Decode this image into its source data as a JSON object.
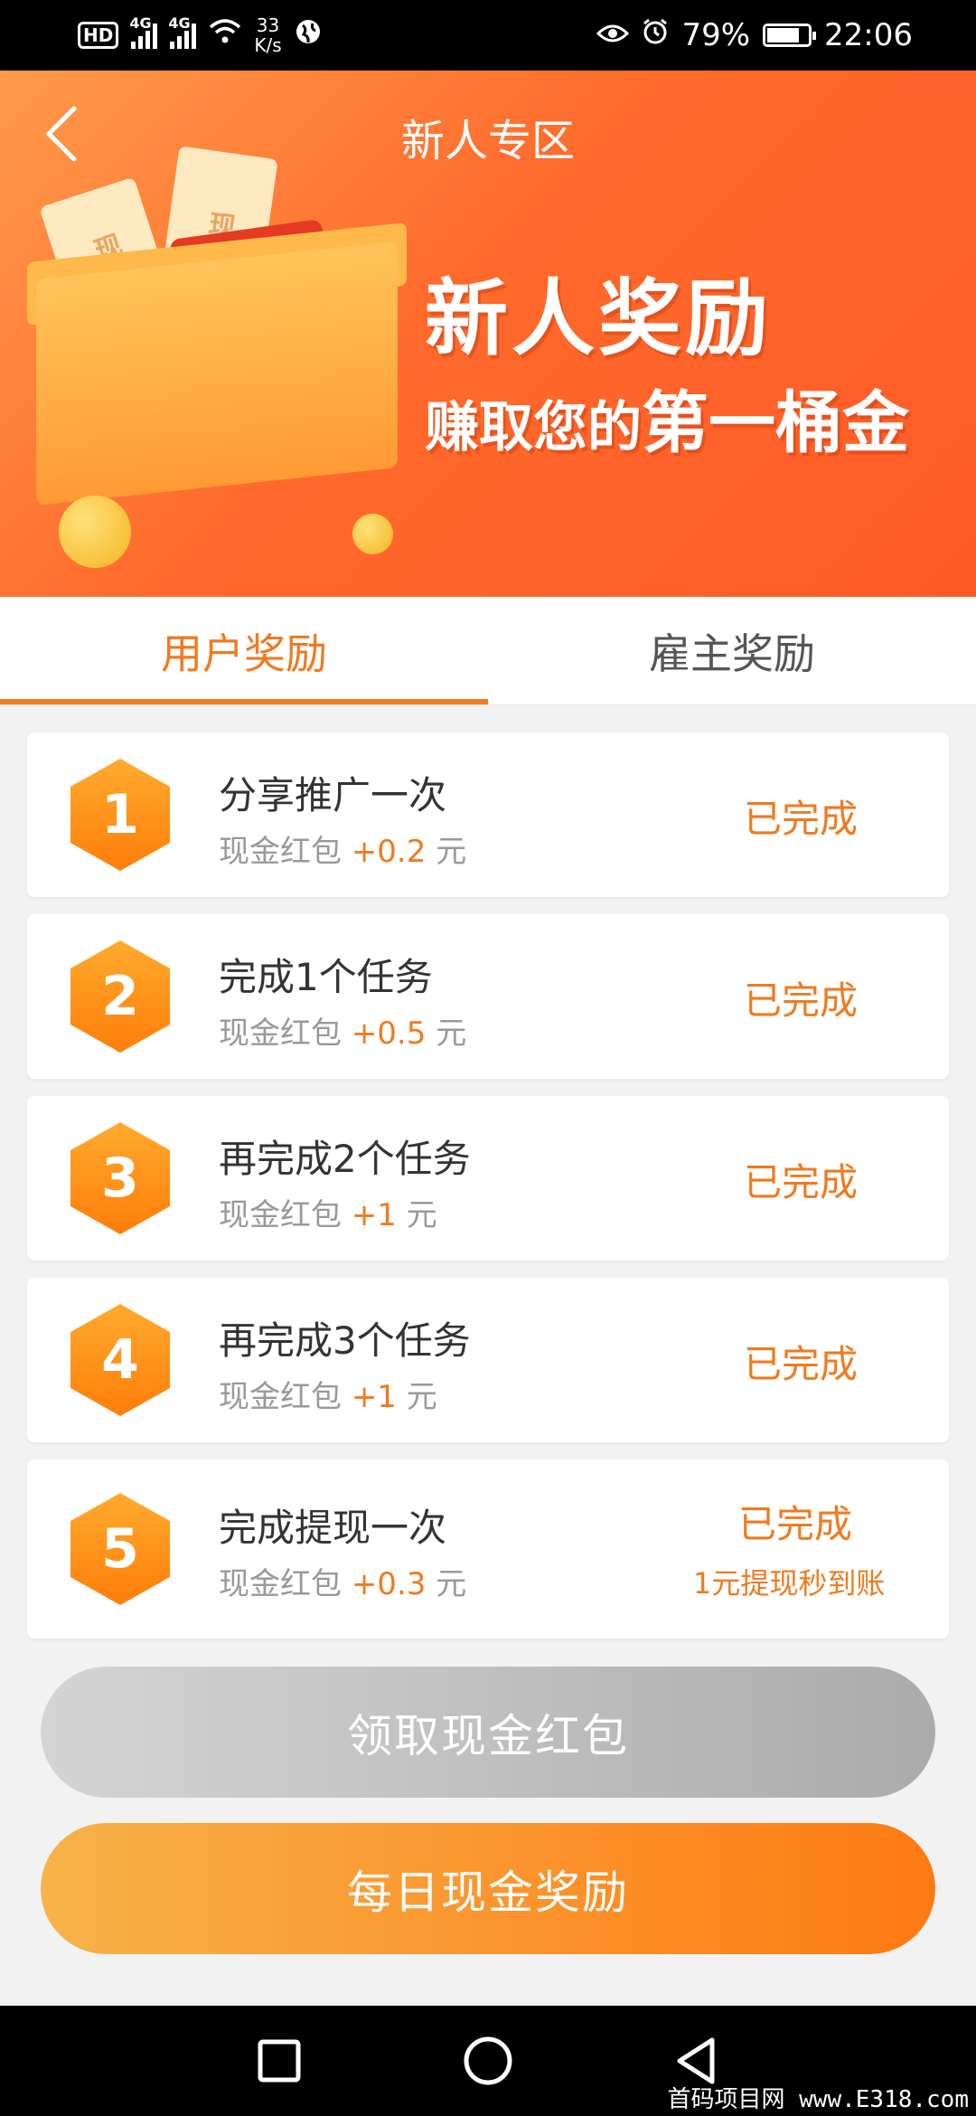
{
  "status_bar": {
    "hd": "HD",
    "net1": "4G",
    "net2": "4G",
    "speed_value": "33",
    "speed_unit": "K/s",
    "battery": "79%",
    "time": "22:06"
  },
  "header": {
    "title": "新人专区"
  },
  "banner": {
    "ticket1": "现金券",
    "ticket2": "现金",
    "headline": "新人奖励",
    "sub_prefix": "赚取您的",
    "sub_highlight": "第一桶金"
  },
  "tabs": [
    {
      "label": "用户奖励",
      "active": true
    },
    {
      "label": "雇主奖励",
      "active": false
    }
  ],
  "tasks": [
    {
      "num": "1",
      "title": "分享推广一次",
      "reward_prefix": "现金红包",
      "amount": "+0.2",
      "unit": "元",
      "status": "已完成"
    },
    {
      "num": "2",
      "title": "完成1个任务",
      "reward_prefix": "现金红包",
      "amount": "+0.5",
      "unit": "元",
      "status": "已完成"
    },
    {
      "num": "3",
      "title": "再完成2个任务",
      "reward_prefix": "现金红包",
      "amount": "+1",
      "unit": "元",
      "status": "已完成"
    },
    {
      "num": "4",
      "title": "再完成3个任务",
      "reward_prefix": "现金红包",
      "amount": "+1",
      "unit": "元",
      "status": "已完成"
    },
    {
      "num": "5",
      "title": "完成提现一次",
      "reward_prefix": "现金红包",
      "amount": "+0.3",
      "unit": "元",
      "status": "已完成",
      "sub_status": "1元提现秒到账"
    }
  ],
  "buttons": {
    "claim": "领取现金红包",
    "daily": "每日现金奖励"
  },
  "watermark": "首码项目网 www.E318.com",
  "colors": {
    "accent": "#f07a1f",
    "banner": "#ff6a2c"
  }
}
